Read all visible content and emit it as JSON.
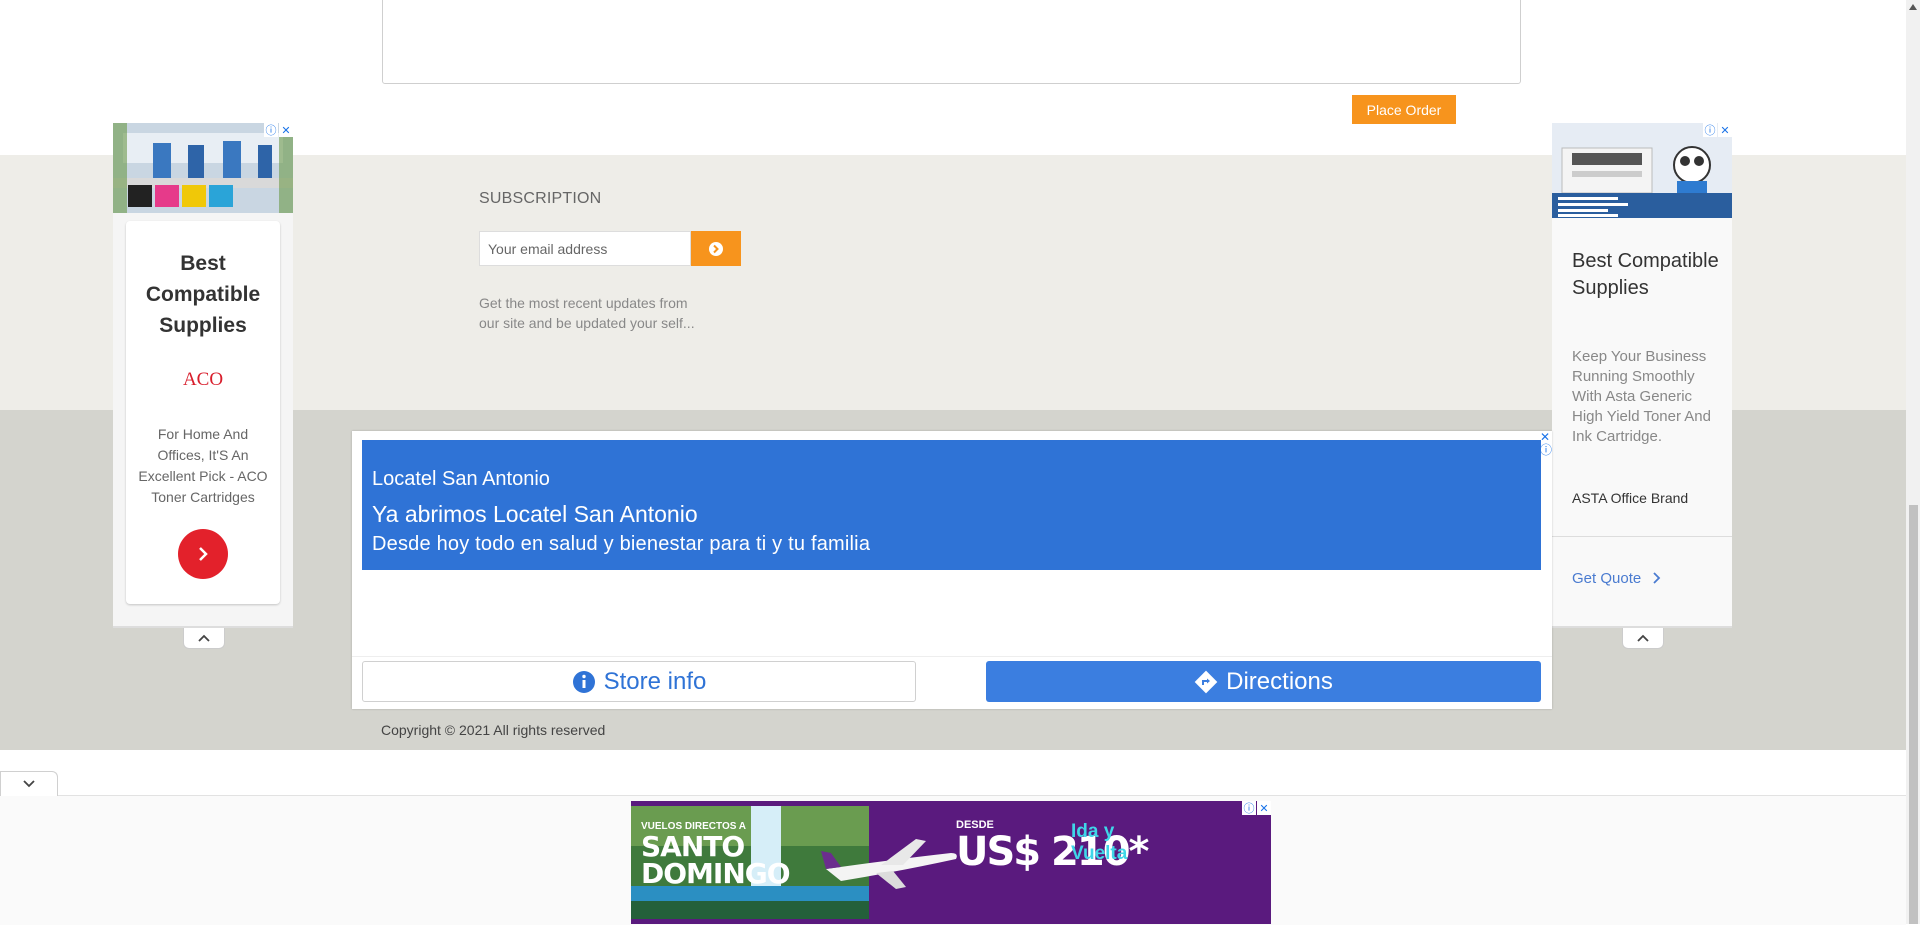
{
  "order": {
    "place_order_label": "Place Order"
  },
  "subscription": {
    "title": "SUBSCRIPTION",
    "email_placeholder": "Your email address",
    "description": "Get the most recent updates from our site and be updated your self..."
  },
  "footer": {
    "copyright": "Copyright © 2021 All rights reserved"
  },
  "ad_left": {
    "title": "Best Compatible Supplies",
    "logo_text": "ACO",
    "body": "For Home And Offices, It'S An Excellent Pick - ACO Toner Cartridges"
  },
  "ad_right": {
    "title": "Best Compatible Supplies",
    "body": "Keep Your Business Running Smoothly With Asta Generic High Yield Toner And Ink Cartridge.",
    "brand": "ASTA Office Brand",
    "cta": "Get Quote"
  },
  "ad_center": {
    "store_name": "Locatel San Antonio",
    "headline": "Ya abrimos Locatel San Antonio",
    "subline": "Desde hoy todo en salud y bienestar para ti y tu familia",
    "store_info_label": "Store info",
    "directions_label": "Directions"
  },
  "ad_bottom": {
    "kicker": "VUELOS DIRECTOS A",
    "destination": "SANTO DOMINGO",
    "desde": "DESDE",
    "price": "US$ 210*",
    "trip": "Ida y Vuelta"
  },
  "icons": {
    "info_icon": "ⓘ",
    "close_icon": "✕"
  },
  "colors": {
    "accent_orange": "#f7941d",
    "ad_blue": "#2f73d6",
    "ad_red": "#e3212b",
    "ad_purple": "#5a1a7e"
  }
}
